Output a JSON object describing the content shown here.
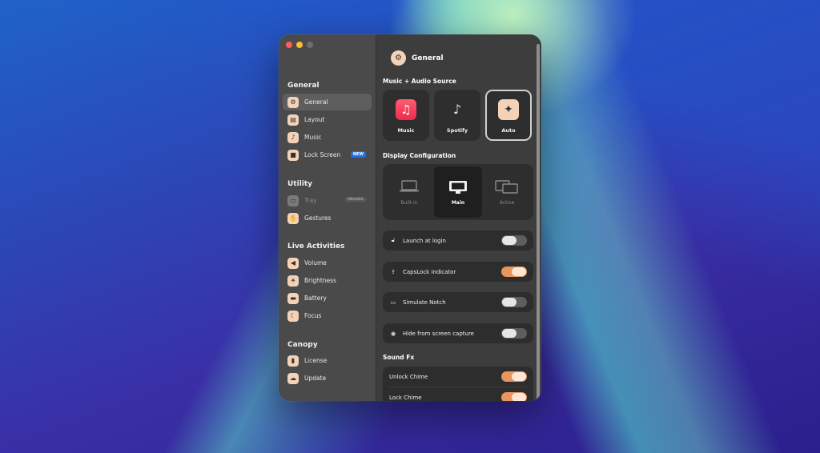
{
  "sidebar": {
    "window_controls": [
      "close",
      "minimize",
      "zoom"
    ],
    "sections": [
      {
        "title": "General",
        "items": [
          {
            "label": "General",
            "icon": "gear-icon",
            "active": true
          },
          {
            "label": "Layout",
            "icon": "layout-icon"
          },
          {
            "label": "Music",
            "icon": "music-icon"
          },
          {
            "label": "Lock Screen",
            "icon": "lock-icon",
            "badge": "NEW"
          }
        ]
      },
      {
        "title": "Utility",
        "items": [
          {
            "label": "Tray",
            "icon": "tray-icon",
            "badge": "PAUSED",
            "disabled": true
          },
          {
            "label": "Gestures",
            "icon": "hand-icon"
          }
        ]
      },
      {
        "title": "Live Activities",
        "items": [
          {
            "label": "Volume",
            "icon": "speaker-icon"
          },
          {
            "label": "Brightness",
            "icon": "sun-icon"
          },
          {
            "label": "Battery",
            "icon": "battery-icon"
          },
          {
            "label": "Focus",
            "icon": "moon-icon"
          }
        ]
      },
      {
        "title": "Canopy",
        "items": [
          {
            "label": "License",
            "icon": "license-icon"
          },
          {
            "label": "Update",
            "icon": "cloud-icon"
          }
        ]
      }
    ]
  },
  "main": {
    "title": "General",
    "music_source": {
      "title": "Music + Audio Source",
      "options": [
        {
          "label": "Music",
          "icon": "apple-music-icon"
        },
        {
          "label": "Spotify",
          "icon": "note-icon"
        },
        {
          "label": "Auto",
          "icon": "sparkle-icon",
          "selected": true
        }
      ]
    },
    "display": {
      "title": "Display Configuration",
      "options": [
        {
          "label": "Built-in",
          "icon": "laptop-icon"
        },
        {
          "label": "Main",
          "icon": "monitor-icon",
          "selected": true
        },
        {
          "label": "Active",
          "icon": "dual-monitor-icon"
        }
      ]
    },
    "toggles": [
      {
        "label": "Launch at login",
        "icon": "unlock-icon",
        "on": false
      },
      {
        "label": "CapsLock indicator",
        "icon": "caps-icon",
        "on": true
      },
      {
        "label": "Simulate Notch",
        "icon": "laptop-small-icon",
        "on": false
      },
      {
        "label": "Hide from screen capture",
        "icon": "eye-icon",
        "on": false
      }
    ],
    "sound": {
      "title": "Sound Fx",
      "items": [
        {
          "label": "Unlock Chime",
          "on": true
        },
        {
          "label": "Lock Chime",
          "on": true
        }
      ]
    }
  },
  "colors": {
    "accent_toggle": "#e8955e",
    "icon_bg": "#f4d2b8",
    "new_badge": "#1d6fe6"
  }
}
